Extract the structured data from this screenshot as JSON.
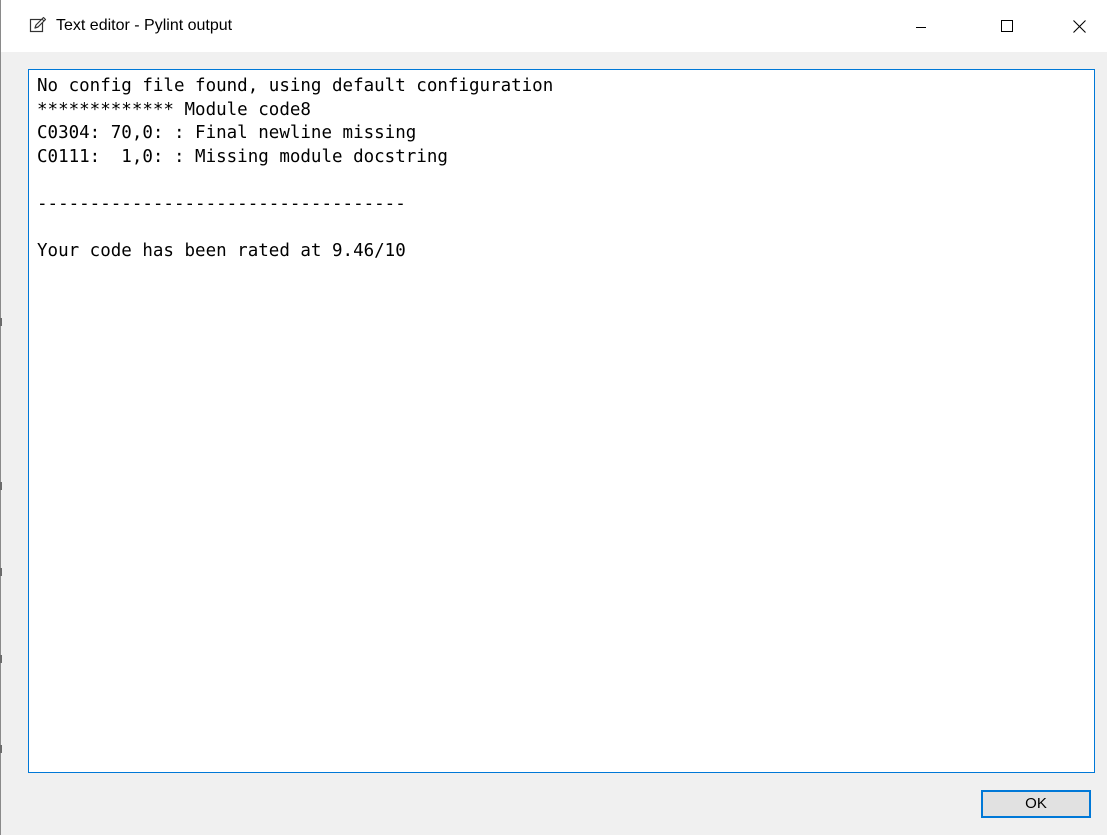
{
  "window": {
    "title": "Text editor - Pylint output",
    "title_icon": "edit-icon",
    "controls": {
      "minimize_icon": "minimize-icon",
      "maximize_icon": "maximize-icon",
      "close_icon": "close-icon"
    }
  },
  "editor": {
    "lines": [
      "No config file found, using default configuration",
      "************* Module code8",
      "C0304: 70,0: : Final newline missing",
      "C0111:  1,0: : Missing module docstring",
      "",
      "-----------------------------------",
      "",
      "Your code has been rated at 9.46/10"
    ]
  },
  "footer": {
    "ok_label": "OK"
  },
  "colors": {
    "accent": "#0078d7",
    "dialog_bg": "#f0f0f0",
    "button_bg": "#e1e1e1"
  }
}
